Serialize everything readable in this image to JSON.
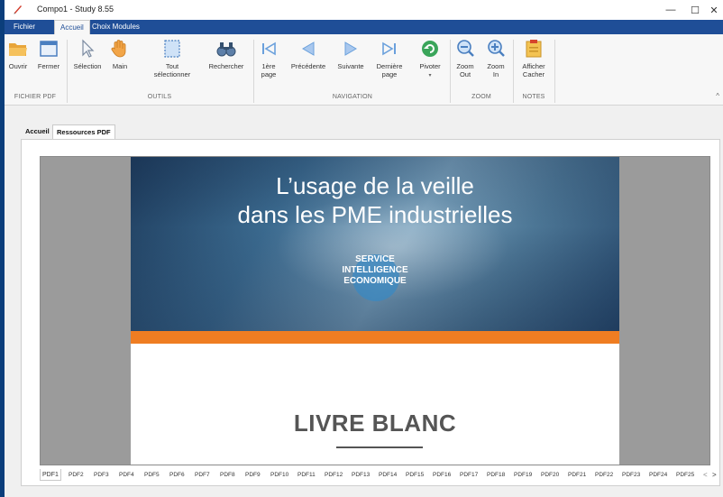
{
  "window": {
    "title": "Compo1 - Study 8.55",
    "controls": {
      "minimize": "—",
      "maximize": "☐",
      "close": "✕"
    }
  },
  "menu_tabs": [
    "Fichier",
    "Accueil",
    "Choix Modules"
  ],
  "ribbon": {
    "groups": {
      "fichier": "FICHIER PDF",
      "outils": "OUTILS",
      "navigation": "NAVIGATION",
      "zoom": "ZOOM",
      "notes": "NOTES"
    },
    "buttons": {
      "ouvrir": "Ouvrir",
      "fermer": "Fermer",
      "selection": "Sélection",
      "main": "Main",
      "tout_selectionner_1": "Tout",
      "tout_selectionner_2": "sélectionner",
      "rechercher": "Rechercher",
      "premiere_1": "1ère",
      "premiere_2": "page",
      "precedente": "Précédente",
      "suivante": "Suivante",
      "derniere_1": "Dernière",
      "derniere_2": "page",
      "pivoter": "Pivoter",
      "pivoter_arrow": "▾",
      "zoom_out_1": "Zoom",
      "zoom_out_2": "Out",
      "zoom_in_1": "Zoom",
      "zoom_in_2": "In",
      "afficher_1": "Afficher",
      "afficher_2": "Cacher"
    },
    "collapse": "^"
  },
  "doc_tabs": [
    "Accueil",
    "Ressources PDF"
  ],
  "document": {
    "title_line1": "L’usage de la veille",
    "title_line2": "dans les PME industrielles",
    "service_line1": "SERVICE",
    "service_line2": "INTELLIGENCE",
    "service_line3": "ECONOMIQUE",
    "livre": "LIVRE BLANC"
  },
  "pdf_tabs": [
    "PDF1",
    "PDF2",
    "PDF3",
    "PDF4",
    "PDF5",
    "PDF6",
    "PDF7",
    "PDF8",
    "PDF9",
    "PDF10",
    "PDF11",
    "PDF12",
    "PDF13",
    "PDF14",
    "PDF15",
    "PDF16",
    "PDF17",
    "PDF18",
    "PDF19",
    "PDF20",
    "PDF21",
    "PDF22",
    "PDF23",
    "PDF24",
    "PDF25"
  ],
  "pdf_nav": {
    "prev": "<",
    "next": ">"
  },
  "colors": {
    "accent": "#1f4e97",
    "orange": "#ef7d22"
  }
}
